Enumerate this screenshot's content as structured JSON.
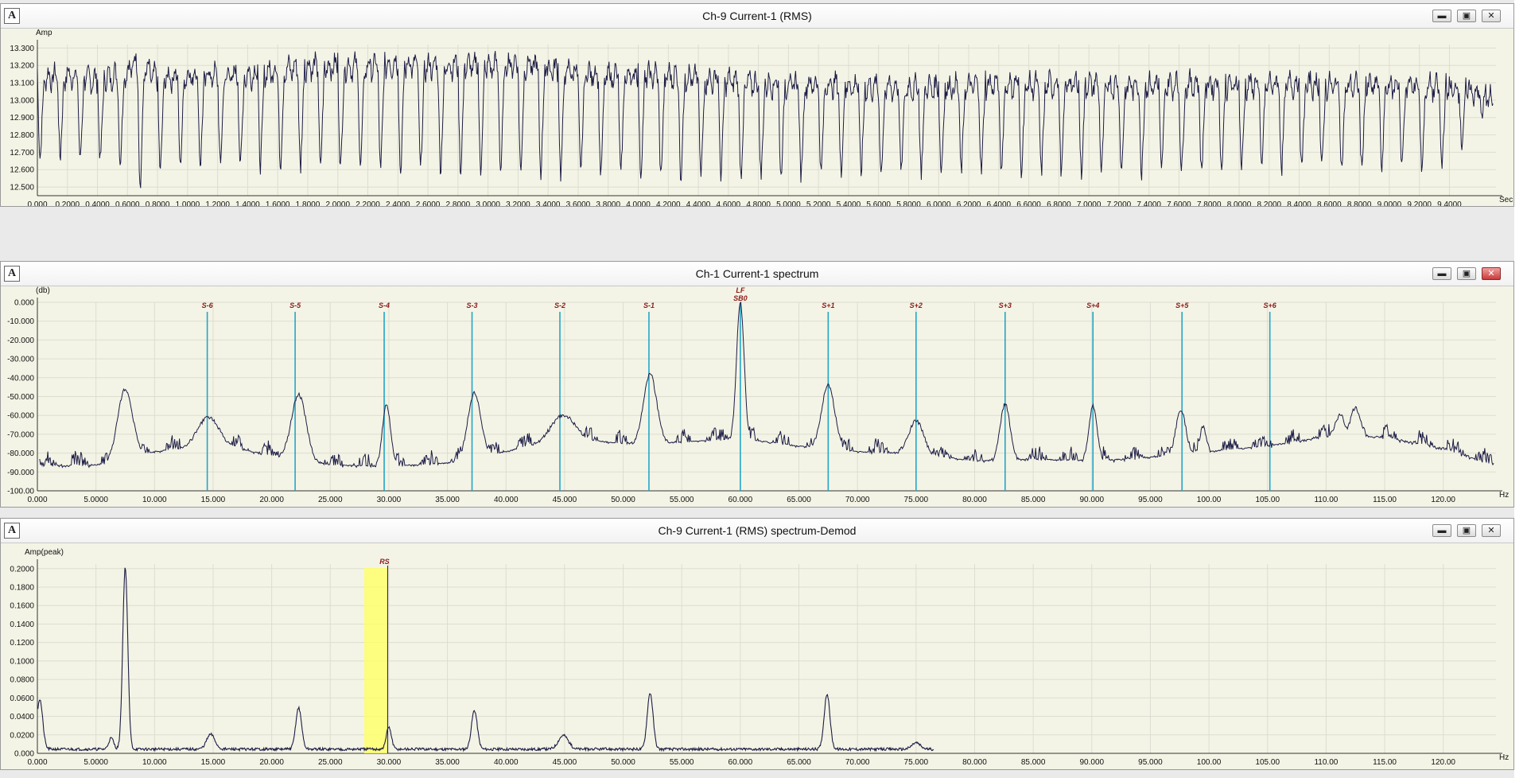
{
  "colors": {
    "plot_bg": "#f4f4e6",
    "grid": "#dcdcd0",
    "trace": "#1c1c46",
    "sideband_line": "#22a6c8",
    "sideband_label": "#8b1a1a",
    "highlight": "#ffff66"
  },
  "panels": [
    {
      "title": "Ch-9 Current-1 (RMS)",
      "icon": "A",
      "controls": [
        "minimize-icon",
        "maximize-icon",
        "close-icon"
      ]
    },
    {
      "title": "Ch-1 Current-1 spectrum",
      "icon": "A",
      "controls": [
        "minimize-icon",
        "maximize-icon",
        "close-icon"
      ]
    },
    {
      "title": "Ch-9 Current-1 (RMS) spectrum-Demod",
      "icon": "A",
      "controls": [
        "minimize-icon",
        "maximize-icon",
        "close-icon"
      ]
    }
  ],
  "chart_data": [
    {
      "type": "line",
      "ylabel": "Amp",
      "xlabel": "Sec",
      "ylim": [
        12.45,
        13.32
      ],
      "xlim": [
        0,
        9.71
      ],
      "yticks": [
        "13.300",
        "13.200",
        "13.100",
        "13.000",
        "12.900",
        "12.800",
        "12.700",
        "12.600",
        "12.500"
      ],
      "ytick_values": [
        13.3,
        13.2,
        13.1,
        13.0,
        12.9,
        12.8,
        12.7,
        12.6,
        12.5
      ],
      "xticks": [
        "0.000",
        "0.2000",
        "0.4000",
        "0.6000",
        "0.8000",
        "1.0000",
        "1.2000",
        "1.4000",
        "1.6000",
        "1.8000",
        "2.0000",
        "2.2000",
        "2.4000",
        "2.6000",
        "2.8000",
        "3.0000",
        "3.2000",
        "3.4000",
        "3.6000",
        "3.8000",
        "4.0000",
        "4.2000",
        "4.4000",
        "4.6000",
        "4.8000",
        "5.0000",
        "5.2000",
        "5.4000",
        "5.6000",
        "5.8000",
        "6.0000",
        "6.2000",
        "6.4000",
        "6.6000",
        "6.8000",
        "7.0000",
        "7.2000",
        "7.4000",
        "7.6000",
        "7.8000",
        "8.0000",
        "8.2000",
        "8.4000",
        "8.6000",
        "8.8000",
        "9.0000",
        "9.2000",
        "9.4000"
      ],
      "series": [
        {
          "period": 0.1333,
          "x": [
            0.0,
            0.2,
            0.4,
            0.6,
            0.65,
            0.8,
            1.0,
            1.2,
            1.4,
            1.6,
            1.8,
            2.0,
            2.2,
            2.4,
            2.6,
            2.8,
            3.0,
            3.2,
            3.4,
            3.6,
            3.8,
            4.0,
            4.2,
            4.4,
            4.6,
            4.8,
            5.0,
            5.2,
            5.4,
            5.6,
            5.8,
            6.0,
            6.2,
            6.4,
            6.6,
            6.8,
            7.0,
            7.2,
            7.4,
            7.6,
            7.8,
            8.0,
            8.2,
            8.4,
            8.6,
            8.8,
            9.0,
            9.2,
            9.4,
            9.6,
            9.7
          ],
          "y_max": [
            13.18,
            13.2,
            13.17,
            13.22,
            13.28,
            13.18,
            13.2,
            13.2,
            13.2,
            13.23,
            13.25,
            13.25,
            13.25,
            13.27,
            13.25,
            13.26,
            13.25,
            13.27,
            13.24,
            13.22,
            13.2,
            13.2,
            13.2,
            13.18,
            13.17,
            13.15,
            13.15,
            13.15,
            13.14,
            13.13,
            13.13,
            13.13,
            13.14,
            13.15,
            13.14,
            13.15,
            13.15,
            13.14,
            13.14,
            13.15,
            13.15,
            13.14,
            13.15,
            13.15,
            13.14,
            13.14,
            13.14,
            13.14,
            13.12,
            13.1,
            13.05
          ],
          "y_min": [
            12.66,
            12.66,
            12.65,
            12.62,
            12.45,
            12.58,
            12.62,
            12.62,
            12.61,
            12.61,
            12.6,
            12.6,
            12.6,
            12.57,
            12.6,
            12.58,
            12.58,
            12.58,
            12.56,
            12.56,
            12.56,
            12.56,
            12.55,
            12.55,
            12.56,
            12.56,
            12.55,
            12.57,
            12.57,
            12.57,
            12.58,
            12.58,
            12.58,
            12.58,
            12.58,
            12.57,
            12.57,
            12.58,
            12.58,
            12.58,
            12.58,
            12.6,
            12.6,
            12.6,
            12.6,
            12.6,
            12.6,
            12.6,
            12.62,
            12.9,
            12.95
          ]
        }
      ]
    },
    {
      "type": "line",
      "ylabel": "(db)",
      "xlabel": "Hz",
      "ylim": [
        -100,
        0
      ],
      "xlim": [
        0,
        124.5
      ],
      "yticks": [
        "0.000",
        "-10.000",
        "-20.000",
        "-30.000",
        "-40.000",
        "-50.000",
        "-60.000",
        "-70.000",
        "-80.000",
        "-90.000",
        "-100.00"
      ],
      "ytick_values": [
        0,
        -10,
        -20,
        -30,
        -40,
        -50,
        -60,
        -70,
        -80,
        -90,
        -100
      ],
      "xticks": [
        "0.000",
        "5.0000",
        "10.000",
        "15.000",
        "20.000",
        "25.000",
        "30.000",
        "35.000",
        "40.000",
        "45.000",
        "50.000",
        "55.000",
        "60.000",
        "65.000",
        "70.000",
        "75.000",
        "80.000",
        "85.000",
        "90.000",
        "95.000",
        "100.00",
        "105.00",
        "110.00",
        "115.00",
        "120.00"
      ],
      "xtick_values": [
        0,
        5,
        10,
        15,
        20,
        25,
        30,
        35,
        40,
        45,
        50,
        55,
        60,
        65,
        70,
        75,
        80,
        85,
        90,
        95,
        100,
        105,
        110,
        115,
        120
      ],
      "markers": [
        {
          "label": "S-6",
          "x": 14.5
        },
        {
          "label": "S-5",
          "x": 22.0
        },
        {
          "label": "S-4",
          "x": 29.6
        },
        {
          "label": "S-3",
          "x": 37.1
        },
        {
          "label": "S-2",
          "x": 44.6
        },
        {
          "label": "S-1",
          "x": 52.2
        },
        {
          "label": "S+1",
          "x": 67.5
        },
        {
          "label": "S+2",
          "x": 75.0
        },
        {
          "label": "S+3",
          "x": 82.6
        },
        {
          "label": "S+4",
          "x": 90.1
        },
        {
          "label": "S+5",
          "x": 97.7
        },
        {
          "label": "S+6",
          "x": 105.2
        }
      ],
      "center_marker": {
        "label_top": "LF",
        "label_bottom": "SB0",
        "x": 60.0
      },
      "series": [
        {
          "baseline": [
            [
              0,
              -87
            ],
            [
              5,
              -87
            ],
            [
              10,
              -80
            ],
            [
              15,
              -76
            ],
            [
              20,
              -82
            ],
            [
              25,
              -87
            ],
            [
              30,
              -88
            ],
            [
              35,
              -86
            ],
            [
              40,
              -80
            ],
            [
              45,
              -72
            ],
            [
              50,
              -76
            ],
            [
              55,
              -75
            ],
            [
              60,
              -73
            ],
            [
              65,
              -77
            ],
            [
              70,
              -80
            ],
            [
              75,
              -81
            ],
            [
              80,
              -85
            ],
            [
              85,
              -84
            ],
            [
              90,
              -85
            ],
            [
              95,
              -83
            ],
            [
              100,
              -80
            ],
            [
              105,
              -77
            ],
            [
              110,
              -72
            ],
            [
              115,
              -72
            ],
            [
              120,
              -78
            ],
            [
              124,
              -86
            ]
          ],
          "peaks": [
            {
              "x": 7.5,
              "y": -46,
              "w": 0.9
            },
            {
              "x": 14.6,
              "y": -61,
              "w": 1.3
            },
            {
              "x": 22.3,
              "y": -49,
              "w": 0.9
            },
            {
              "x": 29.8,
              "y": -54,
              "w": 0.5
            },
            {
              "x": 37.3,
              "y": -48,
              "w": 0.8
            },
            {
              "x": 44.9,
              "y": -60,
              "w": 1.4
            },
            {
              "x": 52.3,
              "y": -38,
              "w": 0.8
            },
            {
              "x": 60.0,
              "y": 0,
              "w": 0.45
            },
            {
              "x": 67.5,
              "y": -44,
              "w": 0.8
            },
            {
              "x": 75.0,
              "y": -63,
              "w": 0.9
            },
            {
              "x": 82.6,
              "y": -54,
              "w": 0.6
            },
            {
              "x": 90.1,
              "y": -55,
              "w": 0.5
            },
            {
              "x": 97.6,
              "y": -57,
              "w": 0.6
            },
            {
              "x": 99.5,
              "y": -66,
              "w": 0.4
            },
            {
              "x": 111.2,
              "y": -60,
              "w": 0.6
            },
            {
              "x": 112.5,
              "y": -56,
              "w": 0.6
            }
          ]
        }
      ]
    },
    {
      "type": "line",
      "ylabel": "Amp(peak)",
      "xlabel": "Hz",
      "ylim": [
        0,
        0.205
      ],
      "xlim": [
        0,
        124.5
      ],
      "yticks": [
        "0.2000",
        "0.1800",
        "0.1600",
        "0.1400",
        "0.1200",
        "0.1000",
        "0.0800",
        "0.0600",
        "0.0400",
        "0.0200",
        "0.000"
      ],
      "ytick_values": [
        0.2,
        0.18,
        0.16,
        0.14,
        0.12,
        0.1,
        0.08,
        0.06,
        0.04,
        0.02,
        0.0
      ],
      "xticks": [
        "0.000",
        "5.0000",
        "10.000",
        "15.000",
        "20.000",
        "25.000",
        "30.000",
        "35.000",
        "40.000",
        "45.000",
        "50.000",
        "55.000",
        "60.000",
        "65.000",
        "70.000",
        "75.000",
        "80.000",
        "85.000",
        "90.000",
        "95.000",
        "100.00",
        "105.00",
        "110.00",
        "115.00",
        "120.00"
      ],
      "xtick_values": [
        0,
        5,
        10,
        15,
        20,
        25,
        30,
        35,
        40,
        45,
        50,
        55,
        60,
        65,
        70,
        75,
        80,
        85,
        90,
        95,
        100,
        105,
        110,
        115,
        120
      ],
      "highlight_band": {
        "x_from": 27.9,
        "x_to": 29.9
      },
      "cursor": {
        "label": "RS",
        "x": 29.9
      },
      "series": [
        {
          "peaks": [
            {
              "x": 0.2,
              "y": 0.054,
              "w": 0.35
            },
            {
              "x": 6.3,
              "y": 0.012,
              "w": 0.3
            },
            {
              "x": 7.5,
              "y": 0.197,
              "w": 0.3
            },
            {
              "x": 14.8,
              "y": 0.016,
              "w": 0.5
            },
            {
              "x": 22.3,
              "y": 0.045,
              "w": 0.35
            },
            {
              "x": 30.0,
              "y": 0.024,
              "w": 0.3
            },
            {
              "x": 37.3,
              "y": 0.042,
              "w": 0.35
            },
            {
              "x": 44.9,
              "y": 0.015,
              "w": 0.6
            },
            {
              "x": 52.3,
              "y": 0.061,
              "w": 0.35
            },
            {
              "x": 67.4,
              "y": 0.06,
              "w": 0.35
            },
            {
              "x": 75.0,
              "y": 0.007,
              "w": 0.5
            }
          ],
          "floor": 0.003,
          "x_end": 76.5
        }
      ]
    }
  ]
}
